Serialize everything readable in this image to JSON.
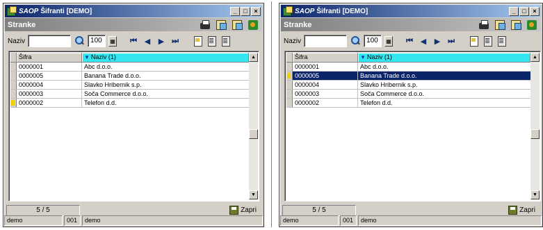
{
  "window": {
    "brand": "SAOP",
    "title": "Šifranti [DEMO]",
    "minimize": "_",
    "maximize": "□",
    "close": "×"
  },
  "banner": {
    "title": "Stranke"
  },
  "icons": {
    "print": "printer-icon",
    "copy": "copy-icon",
    "copy2": "copy-records-icon",
    "exit": "exit-icon",
    "search": "search-icon",
    "calc": "calculator-icon",
    "new": "new-record-icon",
    "edit": "edit-record-icon",
    "delete": "delete-record-icon"
  },
  "toolbar": {
    "search_label": "Naziv",
    "search_value": "",
    "limit_value": "100",
    "nav_first": "⏮",
    "nav_prev": "◀",
    "nav_next": "▶",
    "nav_last": "⏭"
  },
  "table": {
    "columns": [
      "Šifra",
      "Naziv (1)"
    ],
    "rows": [
      {
        "sifra": "0000001",
        "naziv": "Abc d.o.o."
      },
      {
        "sifra": "0000005",
        "naziv": "Banana Trade d.o.o."
      },
      {
        "sifra": "0000004",
        "naziv": "Slavko Hribernik s.p."
      },
      {
        "sifra": "0000003",
        "naziv": "Soča Commerce d.o.o."
      },
      {
        "sifra": "0000002",
        "naziv": "Telefon d.d."
      }
    ]
  },
  "footer": {
    "counter": "5 / 5",
    "save_label": "Zapri"
  },
  "status": {
    "user": "demo",
    "company_code": "001",
    "company_name": "demo"
  },
  "colors": {
    "title_start": "#0a246a",
    "title_end": "#a6caf0",
    "sort_header": "#33e6f0",
    "selection": "#0a246a",
    "row_indicator": "#f0d000"
  }
}
